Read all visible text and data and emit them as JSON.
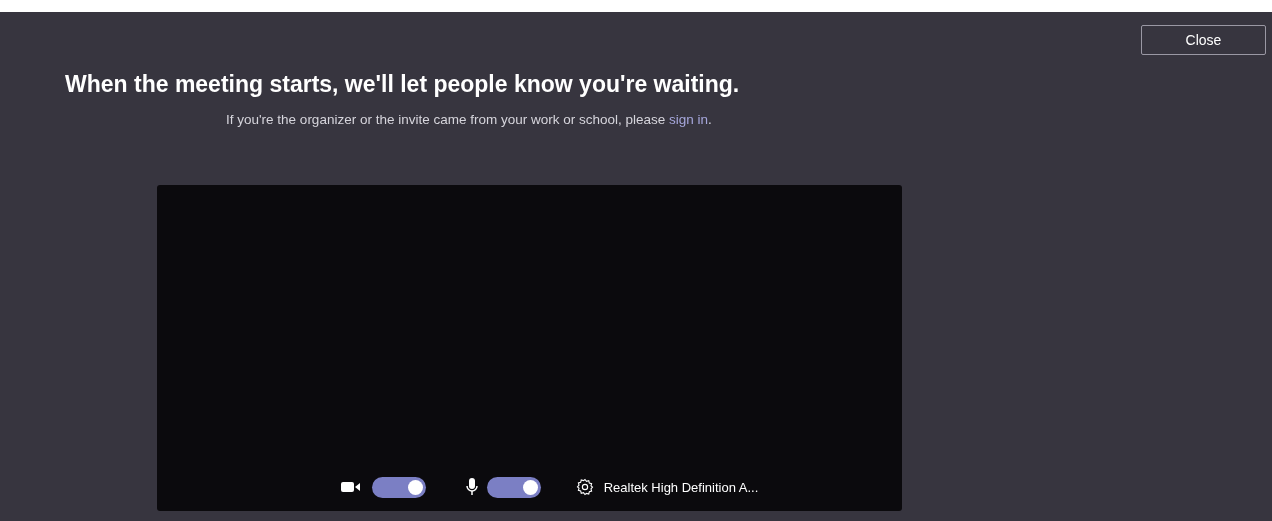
{
  "close_button": "Close",
  "heading": "When the meeting starts, we'll let people know you're waiting.",
  "subtitle": {
    "text": "If you're the organizer or the invite came from your work or school, please ",
    "link": "sign in",
    "end": "."
  },
  "controls": {
    "camera": {
      "on": true
    },
    "microphone": {
      "on": true
    },
    "audio_device": "Realtek High Definition A..."
  }
}
